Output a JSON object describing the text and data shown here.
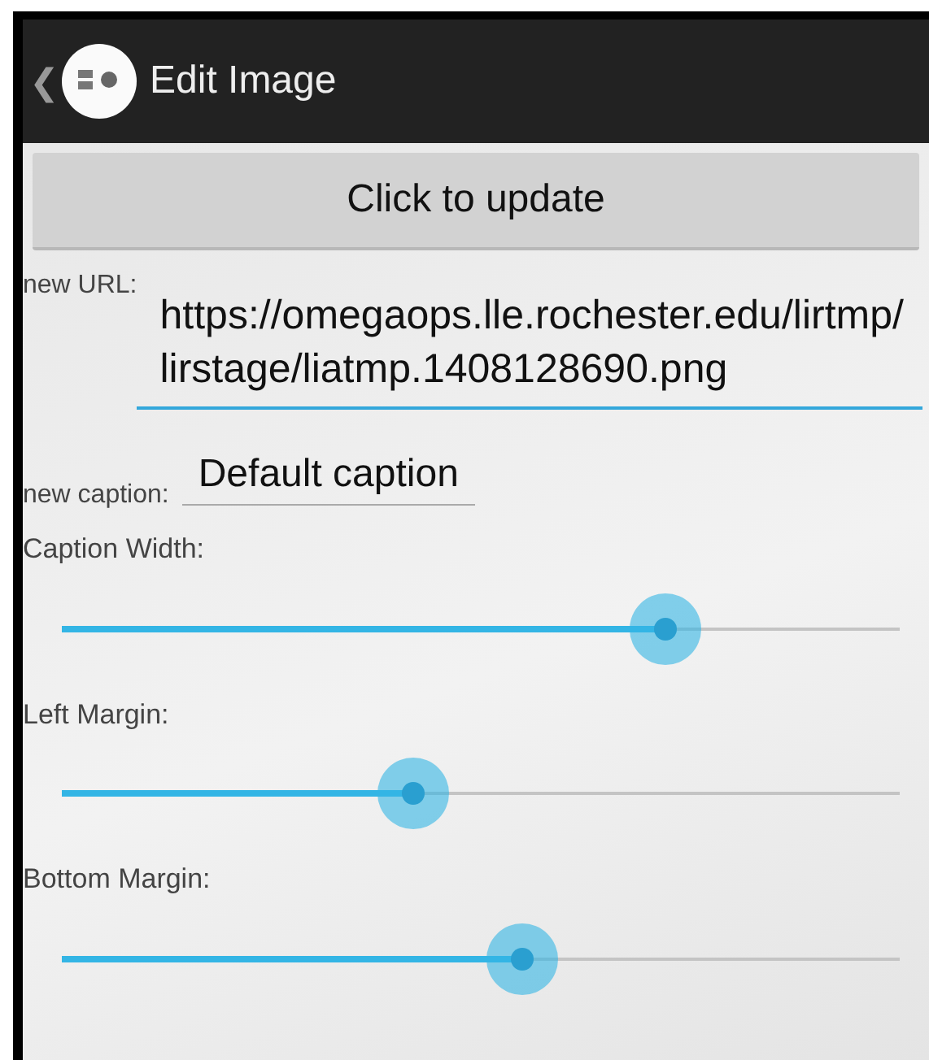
{
  "action_bar": {
    "title": "Edit Image",
    "back": "❮"
  },
  "update_button": {
    "label": "Click to update"
  },
  "url_field": {
    "label": "new URL:",
    "value": "https://omegaops.lle.rochester.edu/lirtmp/lirstage/liatmp.1408128690.png",
    "focused": true
  },
  "caption_field": {
    "label": "new caption:",
    "value": "Default caption",
    "focused": false
  },
  "sliders": [
    {
      "label": "Caption Width:",
      "level": 0.72
    },
    {
      "label": "Left Margin:",
      "level": 0.42
    },
    {
      "label": "Bottom Margin:",
      "level": 0.55
    }
  ]
}
